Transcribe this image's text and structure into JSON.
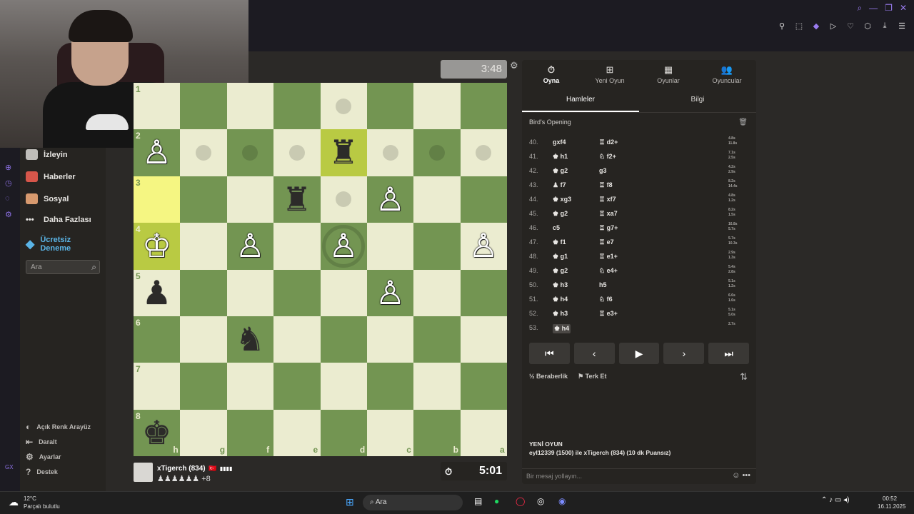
{
  "clocks": {
    "opponent": "3:48",
    "player": "5:01"
  },
  "sidebar": {
    "items": [
      {
        "label": "İzleyin",
        "icon": "binoculars-icon"
      },
      {
        "label": "Haberler",
        "icon": "news-icon"
      },
      {
        "label": "Sosyal",
        "icon": "social-icon"
      },
      {
        "label": "Daha Fazlası",
        "icon": "more-icon"
      }
    ],
    "promo": "Ücretsiz Deneme",
    "search_placeholder": "Ara",
    "bottom": [
      {
        "label": "Açık Renk Arayüz",
        "icon": "contrast-icon"
      },
      {
        "label": "Daralt",
        "icon": "collapse-icon"
      },
      {
        "label": "Ayarlar",
        "icon": "gear-icon"
      },
      {
        "label": "Destek",
        "icon": "help-icon"
      }
    ]
  },
  "board": {
    "files": [
      "h",
      "g",
      "f",
      "e",
      "d",
      "c",
      "b",
      "a"
    ],
    "ranks": [
      "1",
      "2",
      "3",
      "4",
      "5",
      "6",
      "7",
      "8"
    ],
    "pieces": [
      {
        "sq": "h2",
        "glyph": "♙",
        "color": "white"
      },
      {
        "sq": "d2",
        "glyph": "♜",
        "color": "black"
      },
      {
        "sq": "e3",
        "glyph": "♜",
        "color": "black"
      },
      {
        "sq": "c3",
        "glyph": "♙",
        "color": "white"
      },
      {
        "sq": "h4",
        "glyph": "♔",
        "color": "white"
      },
      {
        "sq": "f4",
        "glyph": "♙",
        "color": "white"
      },
      {
        "sq": "d4",
        "glyph": "♙",
        "color": "white"
      },
      {
        "sq": "a4",
        "glyph": "♙",
        "color": "white"
      },
      {
        "sq": "h5",
        "glyph": "♟",
        "color": "black"
      },
      {
        "sq": "c5",
        "glyph": "♙",
        "color": "white"
      },
      {
        "sq": "f6",
        "glyph": "♞",
        "color": "black"
      },
      {
        "sq": "h8",
        "glyph": "♚",
        "color": "black"
      }
    ],
    "highlights": [
      "h3",
      "h4",
      "d2"
    ],
    "dots": [
      "d1",
      "g2",
      "f2",
      "e2",
      "c2",
      "b2",
      "a2",
      "d3"
    ],
    "ring": "d4"
  },
  "player": {
    "name": "xTigerch (834)",
    "flag": "🇹🇷",
    "captured": "♟♟♟♟♟♟ +8",
    "captured_count": "+8"
  },
  "panel": {
    "tabs": [
      {
        "label": "Oyna",
        "icon": "clock-icon"
      },
      {
        "label": "Yeni Oyun",
        "icon": "plus-icon"
      },
      {
        "label": "Oyunlar",
        "icon": "board-icon"
      },
      {
        "label": "Oyuncular",
        "icon": "players-icon"
      }
    ],
    "subtabs": [
      "Hamleler",
      "Bilgi"
    ],
    "opening": "Bird's Opening",
    "moves": [
      {
        "no": "40.",
        "w": "gxf4",
        "b": "♖ d2+",
        "t": [
          "4.8s",
          "11.8s"
        ]
      },
      {
        "no": "41.",
        "w": "♚ h1",
        "b": "♘ f2+",
        "t": [
          "7.1s",
          "2.5s"
        ]
      },
      {
        "no": "42.",
        "w": "♚ g2",
        "b": "g3",
        "t": [
          "4.2s",
          "2.9s"
        ]
      },
      {
        "no": "43.",
        "w": "♟ f7",
        "b": "♖ f8",
        "t": [
          "8.2s",
          "14.4s"
        ]
      },
      {
        "no": "44.",
        "w": "♚ xg3",
        "b": "♖ xf7",
        "t": [
          "4.8s",
          "1.2s"
        ]
      },
      {
        "no": "45.",
        "w": "♚ g2",
        "b": "♖ xa7",
        "t": [
          "8.2s",
          "1.5s"
        ]
      },
      {
        "no": "46.",
        "w": "c5",
        "b": "♖ g7+",
        "t": [
          "16.8s",
          "5.7s"
        ]
      },
      {
        "no": "47.",
        "w": "♚ f1",
        "b": "♖ e7",
        "t": [
          "5.7s",
          "10.3s"
        ]
      },
      {
        "no": "48.",
        "w": "♚ g1",
        "b": "♖ e1+",
        "t": [
          "2.9s",
          "1.3s"
        ]
      },
      {
        "no": "49.",
        "w": "♚ g2",
        "b": "♘ e4+",
        "t": [
          "5.4s",
          "2.8s"
        ]
      },
      {
        "no": "50.",
        "w": "♚ h3",
        "b": "h5",
        "t": [
          "5.1s",
          "1.2s"
        ]
      },
      {
        "no": "51.",
        "w": "♚ h4",
        "b": "♘ f6",
        "t": [
          "6.6s",
          "1.6s"
        ]
      },
      {
        "no": "52.",
        "w": "♚ h3",
        "b": "♖ e3+",
        "t": [
          "5.1s",
          "5.0s"
        ]
      },
      {
        "no": "53.",
        "w": "♚ h4",
        "b": "",
        "t": [
          "2.7s",
          ""
        ]
      }
    ],
    "nav": [
      "⏮",
      "‹",
      "▶",
      "›",
      "⏭"
    ],
    "draw": "Beraberlik",
    "resign": "Terk Et",
    "new_game_title": "YENİ OYUN",
    "new_game_desc": "eyl12339 (1500) ile xTigerch (834) (10 dk Puansız)",
    "chat_placeholder": "Bir mesaj yollayın..."
  },
  "taskbar": {
    "weather": "12°C",
    "weather_desc": "Parçalı bulutlu",
    "search": "Ara",
    "time": "00:52",
    "date": "16.11.2025"
  }
}
